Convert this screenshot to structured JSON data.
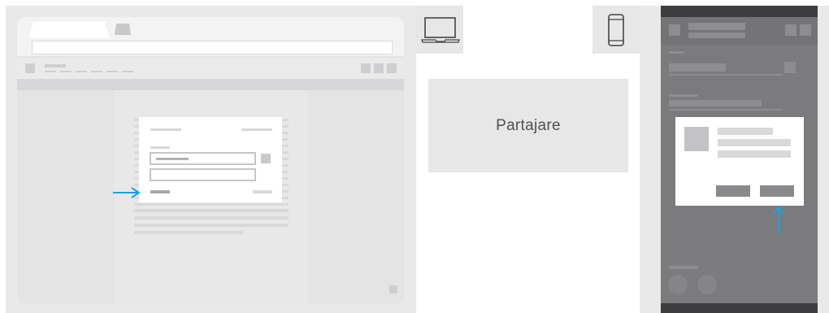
{
  "center_panel": {
    "label": "Partajare"
  },
  "icons": {
    "laptop": "laptop-icon",
    "phone": "phone-icon",
    "arrow_right": "arrow-right-icon",
    "arrow_up": "arrow-up-icon"
  },
  "colors": {
    "accent": "#1aa3df",
    "panel_gray": "#e7e7e8",
    "dark_panel": "#7b7b7e",
    "dark_frame": "#3d3d3f"
  }
}
